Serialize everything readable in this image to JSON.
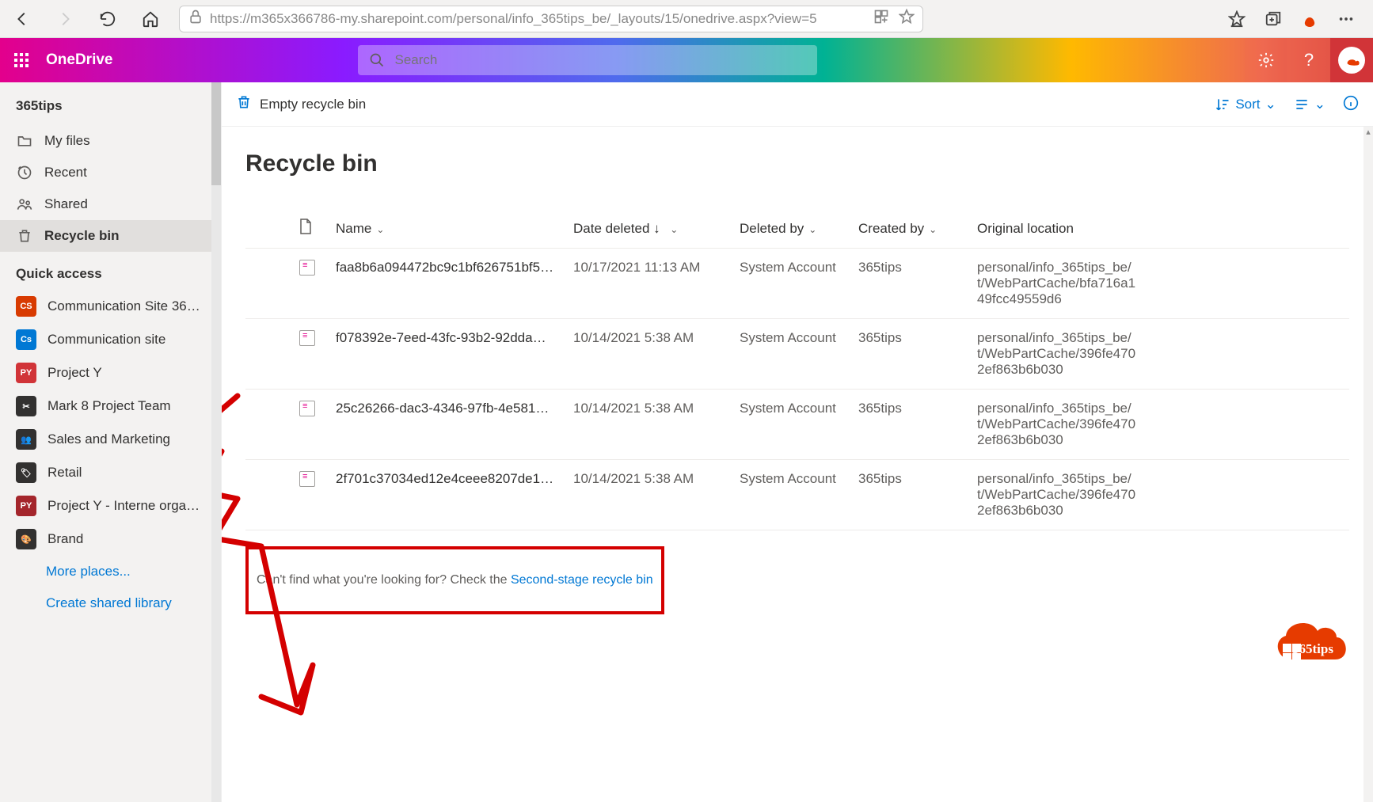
{
  "browser": {
    "url": "https://m365x366786-my.sharepoint.com/personal/info_365tips_be/_layouts/15/onedrive.aspx?view=5"
  },
  "header": {
    "app_name": "OneDrive",
    "search_placeholder": "Search"
  },
  "sidebar": {
    "tenant": "365tips",
    "items": [
      {
        "label": "My files"
      },
      {
        "label": "Recent"
      },
      {
        "label": "Shared"
      },
      {
        "label": "Recycle bin"
      }
    ],
    "quick_access_heading": "Quick access",
    "quick_access": [
      {
        "badge": "CS",
        "color": "#d83b01",
        "label": "Communication Site 36…"
      },
      {
        "badge": "Cs",
        "color": "#0078d4",
        "label": "Communication site"
      },
      {
        "badge": "PY",
        "color": "#d13438",
        "label": "Project Y"
      },
      {
        "badge": "✂",
        "color": "#323130",
        "label": "Mark 8 Project Team"
      },
      {
        "badge": "👥",
        "color": "#323130",
        "label": "Sales and Marketing"
      },
      {
        "badge": "🏷",
        "color": "#323130",
        "label": "Retail"
      },
      {
        "badge": "PY",
        "color": "#a4262c",
        "label": "Project Y - Interne orga…"
      },
      {
        "badge": "🎨",
        "color": "#323130",
        "label": "Brand"
      }
    ],
    "more_places": "More places...",
    "create_shared_library": "Create shared library"
  },
  "commandbar": {
    "empty_label": "Empty recycle bin",
    "sort_label": "Sort"
  },
  "main": {
    "title": "Recycle bin",
    "columns": {
      "name": "Name",
      "date_deleted": "Date deleted",
      "deleted_by": "Deleted by",
      "created_by": "Created by",
      "original_location": "Original location"
    },
    "rows": [
      {
        "name": "faa8b6a094472bc9c1bf626751bf5…",
        "date": "10/17/2021 11:13 AM",
        "deleted_by": "System Account",
        "created_by": "365tips",
        "location": "personal/info_365tips_be/\nt/WebPartCache/bfa716a1\n49fcc49559d6"
      },
      {
        "name": "f078392e-7eed-43fc-93b2-92dda…",
        "date": "10/14/2021 5:38 AM",
        "deleted_by": "System Account",
        "created_by": "365tips",
        "location": "personal/info_365tips_be/\nt/WebPartCache/396fe470\n2ef863b6b030"
      },
      {
        "name": "25c26266-dac3-4346-97fb-4e581…",
        "date": "10/14/2021 5:38 AM",
        "deleted_by": "System Account",
        "created_by": "365tips",
        "location": "personal/info_365tips_be/\nt/WebPartCache/396fe470\n2ef863b6b030"
      },
      {
        "name": "2f701c37034ed12e4ceee8207de1…",
        "date": "10/14/2021 5:38 AM",
        "deleted_by": "System Account",
        "created_by": "365tips",
        "location": "personal/info_365tips_be/\nt/WebPartCache/396fe470\n2ef863b6b030"
      }
    ],
    "footer_prefix": "Can't find what you're looking for? Check the ",
    "footer_link": "Second-stage recycle bin"
  },
  "overlay": {
    "badge_text": "365tips"
  }
}
